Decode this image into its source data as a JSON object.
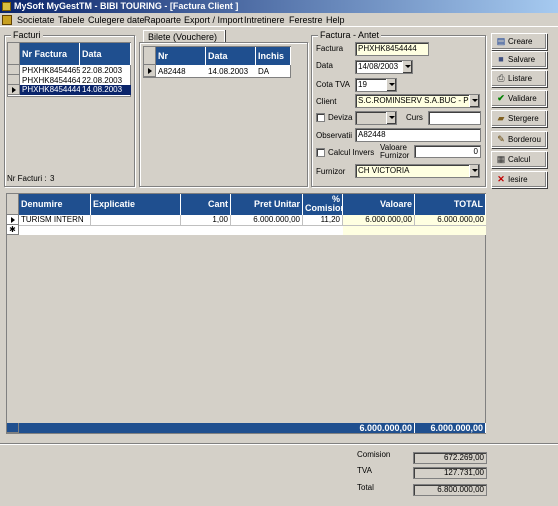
{
  "window": {
    "title": "MySoft MyGestTM - BIBI TOURING - [Factura Client ]"
  },
  "menu": [
    "Societate",
    "Tabele",
    "Culegere date",
    "Rapoarte",
    "Export / Import",
    "Intretinere",
    "Ferestre",
    "Help"
  ],
  "facturi": {
    "label": "Facturi",
    "columns": [
      "Nr Factura",
      "Data"
    ],
    "rows": [
      {
        "nr": "PHXHK8454465",
        "data": "22.08.2003"
      },
      {
        "nr": "PHXHK8454464",
        "data": "22.08.2003"
      },
      {
        "nr": "PHXHK8454444",
        "data": "14.08.2003"
      }
    ],
    "count_label": "Nr Facturi :",
    "count_value": "3"
  },
  "bilete": {
    "tab_label": "Bilete (Vouchere)",
    "columns": [
      "Nr",
      "Data",
      "Inchis"
    ],
    "rows": [
      {
        "nr": "A82448",
        "data": "14.08.2003",
        "inchis": "DA"
      }
    ]
  },
  "antet": {
    "label": "Factura - Antet",
    "factura_label": "Factura",
    "factura_value": "PHXHK8454444",
    "data_label": "Data",
    "data_value": "14/08/2003",
    "cota_label": "Cota TVA",
    "cota_value": "19",
    "client_label": "Client",
    "client_value": "S.C.ROMINSERV S.A.BUC - PL",
    "deviza_label": "Deviza",
    "curs_label": "Curs",
    "observatii_label": "Observatii",
    "observatii_value": "A82448",
    "calcul_invers_label": "Calcul Invers",
    "valoare_furnizor_label": "Valoare Furnizor",
    "valoare_furnizor_value": "0",
    "furnizor_label": "Furnizor",
    "furnizor_value": "CH VICTORIA"
  },
  "buttons": {
    "creare": "Creare",
    "salvare": "Salvare",
    "listare": "Listare",
    "validare": "Validare",
    "stergere": "Stergere",
    "borderou": "Borderou",
    "calcul": "Calcul",
    "iesire": "Iesire"
  },
  "detail": {
    "columns": [
      "Denumire",
      "Explicatie",
      "Cant",
      "Pret Unitar",
      "% Comision",
      "Valoare",
      "TOTAL"
    ],
    "rows": [
      {
        "denumire": "TURISM INTERN",
        "explicatie": "",
        "cant": "1,00",
        "pret": "6.000.000,00",
        "comision": "11,20",
        "valoare": "6.000.000,00",
        "total": "6.000.000,00"
      }
    ],
    "footer_valoare": "6.000.000,00",
    "footer_total": "6.000.000,00"
  },
  "summary": {
    "comision_label": "Comision",
    "comision_value": "672.269,00",
    "tva_label": "TVA",
    "tva_value": "127.731,00",
    "total_label": "Total",
    "total_value": "6.800.000,00"
  },
  "colors": {
    "grid_header": "#1f4f8f",
    "selection": "#0a246a",
    "titlebar": "#0a246a"
  }
}
